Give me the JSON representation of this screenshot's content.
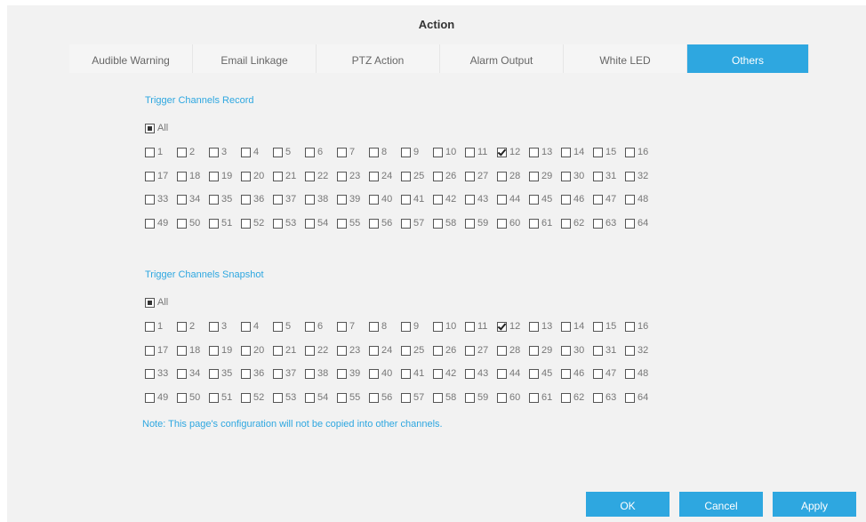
{
  "title": "Action",
  "tabs": [
    {
      "label": "Audible Warning",
      "active": false
    },
    {
      "label": "Email Linkage",
      "active": false
    },
    {
      "label": "PTZ Action",
      "active": false
    },
    {
      "label": "Alarm Output",
      "active": false
    },
    {
      "label": "White LED",
      "active": false
    },
    {
      "label": "Others",
      "active": true
    }
  ],
  "record": {
    "title": "Trigger Channels Record",
    "all_label": "All",
    "all_state": "partial",
    "checked_channels": [
      12
    ]
  },
  "snapshot": {
    "title": "Trigger Channels Snapshot",
    "all_label": "All",
    "all_state": "partial",
    "checked_channels": [
      12
    ]
  },
  "channels": [
    "1",
    "2",
    "3",
    "4",
    "5",
    "6",
    "7",
    "8",
    "9",
    "10",
    "11",
    "12",
    "13",
    "14",
    "15",
    "16",
    "17",
    "18",
    "19",
    "20",
    "21",
    "22",
    "23",
    "24",
    "25",
    "26",
    "27",
    "28",
    "29",
    "30",
    "31",
    "32",
    "33",
    "34",
    "35",
    "36",
    "37",
    "38",
    "39",
    "40",
    "41",
    "42",
    "43",
    "44",
    "45",
    "46",
    "47",
    "48",
    "49",
    "50",
    "51",
    "52",
    "53",
    "54",
    "55",
    "56",
    "57",
    "58",
    "59",
    "60",
    "61",
    "62",
    "63",
    "64"
  ],
  "note": "Note: This page's configuration will not be copied into other channels.",
  "buttons": {
    "ok": "OK",
    "cancel": "Cancel",
    "apply": "Apply"
  },
  "colors": {
    "accent": "#2ea7e0",
    "panel_bg": "#f2f2f2"
  }
}
